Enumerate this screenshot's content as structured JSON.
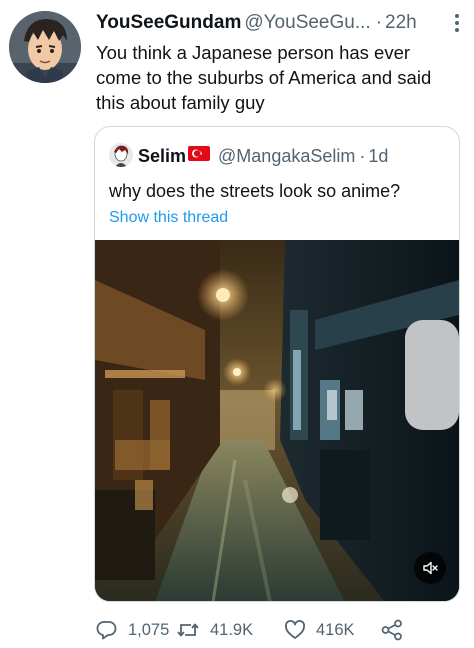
{
  "tweet": {
    "author_name": "YouSeeGundam",
    "author_handle": "@YouSeeGu...",
    "separator": "·",
    "timestamp": "22h",
    "text": "You think a Japanese person has ever come to the suburbs of America and said this about family guy",
    "more_icon": "more-vertical-icon",
    "avatar_icon": "anime-avatar"
  },
  "quote": {
    "author_name": "Selim",
    "flag_icon": "turkey-flag-icon",
    "author_handle": "@MangakaSelim",
    "separator": "·",
    "timestamp": "1d",
    "text": "why does the streets look so anime?",
    "show_thread": "Show this thread",
    "media_icon": "video-alley-night",
    "mute_icon": "speaker-muted-icon"
  },
  "actions": {
    "replies": "1,075",
    "retweets": "41.9K",
    "likes": "416K",
    "reply_icon": "reply-icon",
    "retweet_icon": "retweet-icon",
    "like_icon": "heart-icon",
    "share_icon": "share-icon"
  },
  "colors": {
    "link": "#1d9bf0",
    "secondary_text": "#536471",
    "border": "#cfd9de"
  }
}
